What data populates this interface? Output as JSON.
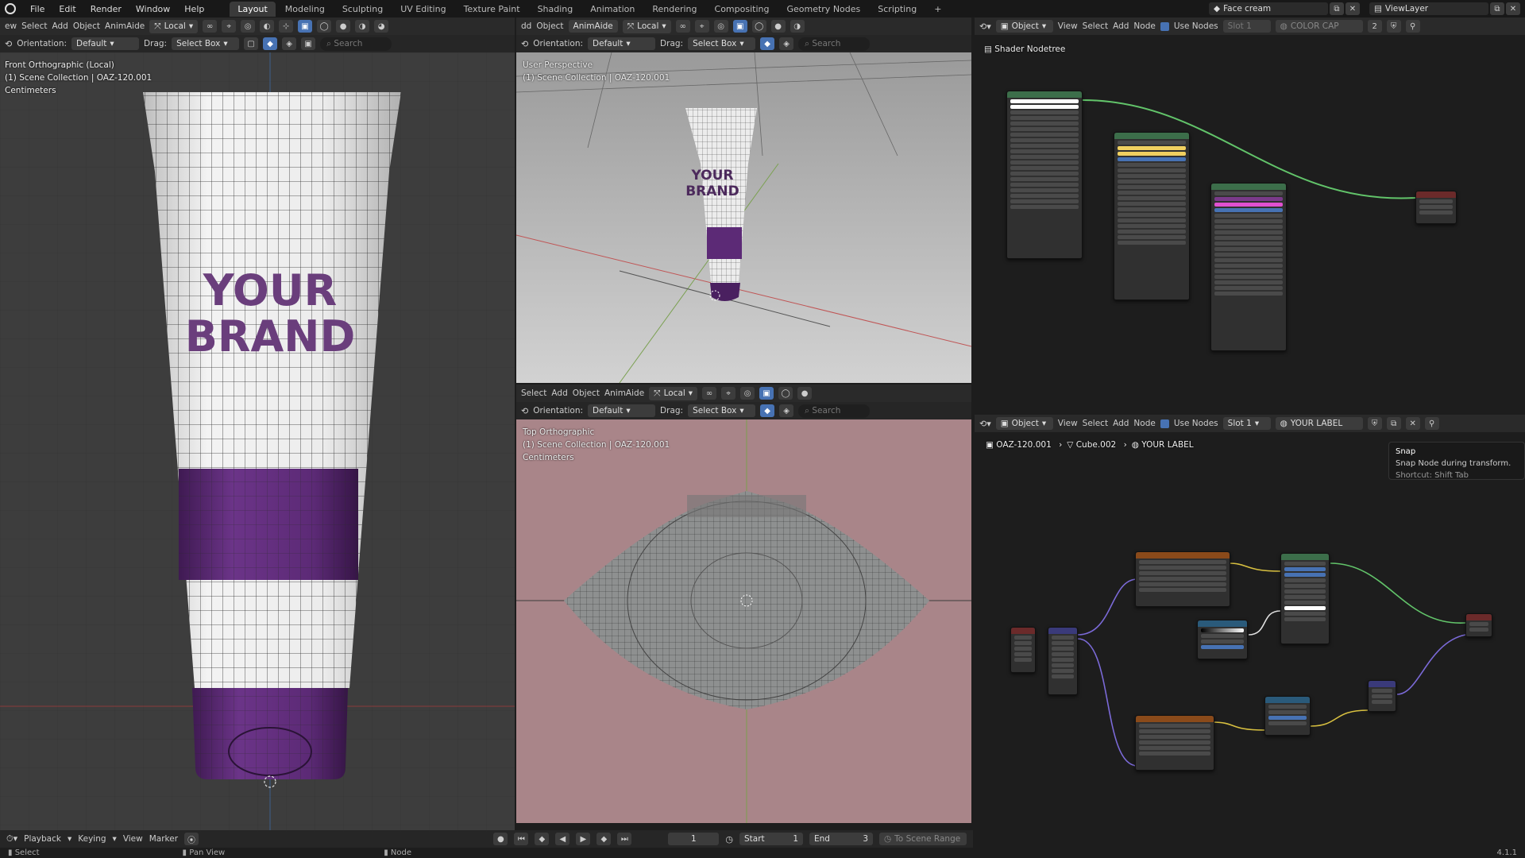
{
  "app": {
    "logo": "blender-icon"
  },
  "topbar": {
    "menus": [
      "File",
      "Edit",
      "Render",
      "Window",
      "Help"
    ],
    "workspaces": [
      "Layout",
      "Modeling",
      "Sculpting",
      "UV Editing",
      "Texture Paint",
      "Shading",
      "Animation",
      "Rendering",
      "Compositing",
      "Geometry Nodes",
      "Scripting"
    ],
    "active_workspace": "Layout",
    "add_tab": "+",
    "scene_name": "Face cream",
    "view_layer": "ViewLayer"
  },
  "vp_left": {
    "header": {
      "menus": [
        "ew",
        "Select",
        "Add",
        "Object",
        "AnimAide"
      ],
      "transform": "Local",
      "orientation_label": "Orientation:",
      "orientation": "Default",
      "drag_label": "Drag:",
      "drag": "Select Box",
      "search": "Search"
    },
    "view_name": "Front Orthographic (Local)",
    "collection": "(1) Scene Collection | OAZ-120.001",
    "units": "Centimeters",
    "brand_line1": "YOUR",
    "brand_line2": "BRAND"
  },
  "vp_top": {
    "header": {
      "menus": [
        "dd",
        "Object",
        "AnimAide"
      ],
      "transform": "Local",
      "orientation_label": "Orientation:",
      "orientation": "Default",
      "drag_label": "Drag:",
      "drag": "Select Box",
      "search": "Search"
    },
    "view_name": "User Perspective",
    "collection": "(1) Scene Collection | OAZ-120.001",
    "brand_line1": "YOUR",
    "brand_line2": "BRAND"
  },
  "vp_bottom": {
    "header": {
      "menus": [
        "Select",
        "Add",
        "Object",
        "AnimAide"
      ],
      "transform": "Local",
      "orientation_label": "Orientation:",
      "orientation": "Default",
      "drag_label": "Drag:",
      "drag": "Select Box",
      "search": "Search"
    },
    "view_name": "Top Orthographic",
    "collection": "(1) Scene Collection | OAZ-120.001",
    "units": "Centimeters"
  },
  "node_top": {
    "header": {
      "mode": "Object",
      "menus": [
        "View",
        "Select",
        "Add",
        "Node"
      ],
      "use_nodes": "Use Nodes",
      "slot": "Slot 1",
      "material": "COLOR CAP",
      "users": "2"
    },
    "breadcrumb": "Shader Nodetree"
  },
  "node_bottom": {
    "header": {
      "mode": "Object",
      "menus": [
        "View",
        "Select",
        "Add",
        "Node"
      ],
      "use_nodes": "Use Nodes",
      "slot": "Slot 1",
      "material": "YOUR LABEL"
    },
    "breadcrumb": [
      "OAZ-120.001",
      "Cube.002",
      "YOUR LABEL"
    ],
    "tooltip": {
      "title": "Snap",
      "desc": "Snap Node during transform.",
      "shortcut": "Shortcut: Shift Tab"
    }
  },
  "timeline": {
    "menus": [
      "Playback",
      "Keying",
      "View",
      "Marker"
    ],
    "current_frame": "1",
    "start_label": "Start",
    "start": "1",
    "end_label": "End",
    "end": "3",
    "range": "To Scene Range"
  },
  "status": {
    "select": "Select",
    "pan": "Pan View",
    "node": "Node",
    "version": "4.1.1"
  },
  "colors": {
    "accent": "#4772b3",
    "purple": "#5a2a74",
    "pink_bg": "#a98589",
    "grid_bg": "#3d3d3d",
    "node_bg": "#1d1d1d"
  }
}
